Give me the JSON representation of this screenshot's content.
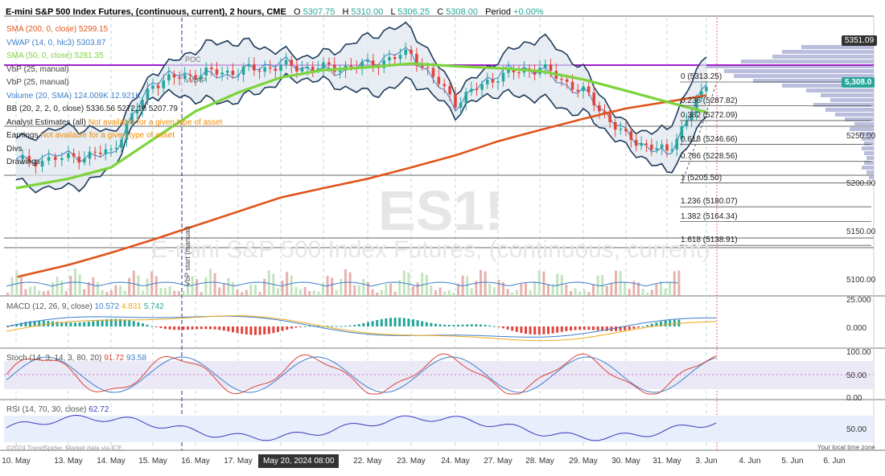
{
  "header": {
    "symbol_title": "E-mini S&P 500 Index Futures, (continuous, current), 2 hours, CME",
    "o_label": "O",
    "o_value": "5307.75",
    "h_label": "H",
    "h_value": "5310.00",
    "l_label": "L",
    "l_value": "5306.25",
    "c_label": "C",
    "c_value": "5308.00",
    "period_label": "Period",
    "period_value": "+0.00%"
  },
  "indicators": [
    {
      "name": "SMA (200, 0, close)",
      "values": "5299.15",
      "color": "#e0541b"
    },
    {
      "name": "VWAP (14, 0, hlc3)",
      "values": "5303.87",
      "color": "#3d7ec9"
    },
    {
      "name": "SMA (50, 0, close)",
      "values": "5281.35",
      "color": "#7dd33b"
    },
    {
      "name": "VbP (25, manual)",
      "values": "",
      "color": "#444444"
    },
    {
      "name": "VbP (25, manual)",
      "values": "",
      "color": "#444444"
    },
    {
      "name": "Volume (20, SMA)",
      "values": "124.009K  12.921K",
      "color": "#3d7ec9"
    },
    {
      "name": "BB (20, 2, 2, 0, close)",
      "values": "5336.56  5272.18  5207.79",
      "color": "#222222"
    },
    {
      "name": "Analyst Estimates (all)",
      "values": "Not available for a given type of asset",
      "color": "#222222"
    },
    {
      "name": "Earnings",
      "values": "Not available for a given type of asset",
      "color": "#222222"
    },
    {
      "name": "Divs",
      "values": "",
      "color": "#222222"
    },
    {
      "name": "Drawings",
      "values": "",
      "color": "#222222"
    }
  ],
  "watermark": {
    "symbol": "ES1!",
    "name": "E-mini S&P 500 Index Futures, (continuous, current)"
  },
  "main_labels": {
    "poc": "POC",
    "vwap": "VWAP",
    "vbp_start": "VbP start (manual)"
  },
  "price_tags": {
    "upper": "5351.09",
    "last": "5,308.0"
  },
  "macd_title": {
    "name": "MACD (12, 26, 9, close)",
    "v1": "10.572",
    "v2": "4.831",
    "v3": "5.742"
  },
  "stoch_title": {
    "name": "Stoch (14, 3, 14, 3, 80, 20)",
    "v1": "91.72",
    "v2": "93.58"
  },
  "rsi_title": {
    "name": "RSI (14, 70, 30, close)",
    "v1": "62.72"
  },
  "footer": {
    "credit": "©2024 TrendSpider. Market data via ICE.",
    "timezone": "Your local time zone"
  },
  "crosshair_label": "May 20, 2024 08:00",
  "colors": {
    "up": "#26a69a",
    "down": "#e0453d",
    "sma200": "#e0541b",
    "sma50": "#7dd33b",
    "vwap": "#3d7ec9",
    "bb": "#1f3b5c",
    "vbp": "#aeb3d6",
    "macd": "#3d7ec9",
    "signal": "#f0a81c",
    "stochK": "#d9443b",
    "stochD": "#3d7ec9",
    "rsi": "#3a3ac0",
    "poc": "#a020c8"
  },
  "chart_data": [
    {
      "type": "candlestick",
      "title": "E-mini S&P 500 Index Futures, (continuous, current), 2 hours, CME",
      "x": [
        "10. May",
        "13. May",
        "14. May",
        "15. May",
        "16. May",
        "17. May",
        "20. May",
        "21. May",
        "22. May",
        "23. May",
        "24. May",
        "27. May",
        "28. May",
        "29. May",
        "30. May",
        "31. May",
        "3. Jun",
        "4. Jun",
        "5. Jun",
        "6. Jun"
      ],
      "close": [
        5228,
        5232,
        5239,
        5312,
        5322,
        5325,
        5330,
        5328,
        5331,
        5344,
        5292,
        5320,
        5329,
        5303,
        5254,
        5238,
        5308
      ],
      "sma200": [
        5105,
        5118,
        5131,
        5145,
        5160,
        5175,
        5190,
        5200,
        5210,
        5222,
        5235,
        5250,
        5262,
        5274,
        5285,
        5292,
        5299
      ],
      "sma50": [
        5200,
        5210,
        5222,
        5252,
        5282,
        5302,
        5318,
        5326,
        5329,
        5333,
        5330,
        5328,
        5325,
        5316,
        5304,
        5292,
        5281
      ],
      "y_ticks": [
        5351.09,
        5308.0,
        5250.0,
        5200.0,
        5150.0,
        5100.0
      ],
      "ylim": [
        5085,
        5375
      ],
      "fib_levels": [
        {
          "ratio": "0",
          "price": "5313.25"
        },
        {
          "ratio": "0.236",
          "price": "5287.82"
        },
        {
          "ratio": "0.382",
          "price": "5272.09"
        },
        {
          "ratio": "0.618",
          "price": "5246.66"
        },
        {
          "ratio": "0.786",
          "price": "5228.56"
        },
        {
          "ratio": "1",
          "price": "5205.50"
        },
        {
          "ratio": "1.236",
          "price": "5180.07"
        },
        {
          "ratio": "1.382",
          "price": "5164.34"
        },
        {
          "ratio": "1.618",
          "price": "5138.91"
        }
      ]
    },
    {
      "type": "line",
      "title": "MACD (12, 26, 9, close)",
      "y_ticks": [
        "25.000",
        "0.000"
      ],
      "macd": 10.572,
      "signal": 4.831,
      "histogram": 5.742
    },
    {
      "type": "line",
      "title": "Stoch (14, 3, 14, 3, 80, 20)",
      "y_ticks": [
        "100.00",
        "50.00",
        "0.00"
      ],
      "k": 91.72,
      "d": 93.58
    },
    {
      "type": "line",
      "title": "RSI (14, 70, 30, close)",
      "y_ticks": [
        "50.00"
      ],
      "rsi": 62.72
    }
  ]
}
